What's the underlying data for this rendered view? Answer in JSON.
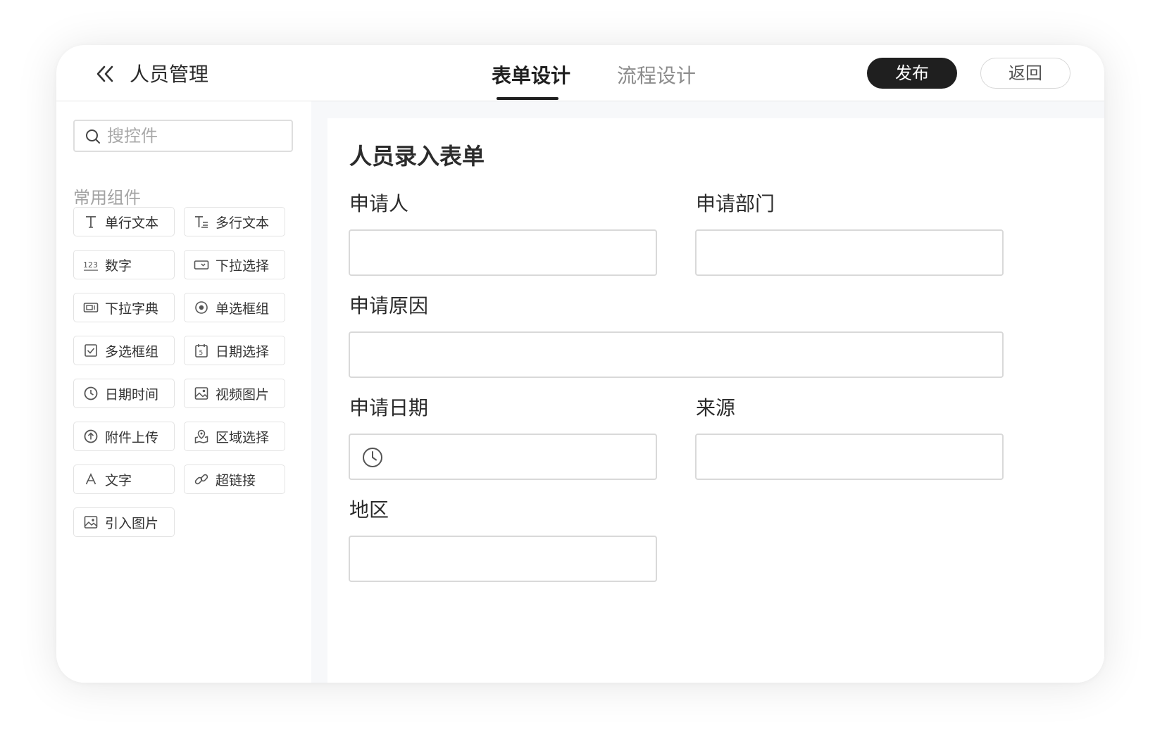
{
  "header": {
    "app_title": "人员管理",
    "tabs": [
      {
        "label": "表单设计",
        "active": true
      },
      {
        "label": "流程设计",
        "active": false
      }
    ],
    "publish_label": "发布",
    "back_label": "返回"
  },
  "sidebar": {
    "search": {
      "placeholder": "搜控件",
      "value": ""
    },
    "section_title": "常用组件",
    "components": [
      {
        "label": "单行文本",
        "icon": "text-icon"
      },
      {
        "label": "多行文本",
        "icon": "multiline-text-icon"
      },
      {
        "label": "数字",
        "icon": "number-icon"
      },
      {
        "label": "下拉选择",
        "icon": "dropdown-icon"
      },
      {
        "label": "下拉字典",
        "icon": "dictionary-icon"
      },
      {
        "label": "单选框组",
        "icon": "radio-icon"
      },
      {
        "label": "多选框组",
        "icon": "checkbox-icon"
      },
      {
        "label": "日期选择",
        "icon": "calendar-icon"
      },
      {
        "label": "日期时间",
        "icon": "clock-icon"
      },
      {
        "label": "视频图片",
        "icon": "media-icon"
      },
      {
        "label": "附件上传",
        "icon": "upload-icon"
      },
      {
        "label": "区域选择",
        "icon": "map-icon"
      },
      {
        "label": "文字",
        "icon": "font-icon"
      },
      {
        "label": "超链接",
        "icon": "link-icon"
      },
      {
        "label": "引入图片",
        "icon": "image-icon"
      }
    ]
  },
  "form": {
    "title": "人员录入表单",
    "fields": [
      {
        "label": "申请人",
        "value": ""
      },
      {
        "label": "申请部门",
        "value": ""
      },
      {
        "label": "申请原因",
        "value": ""
      },
      {
        "label": "申请日期",
        "value": "",
        "icon": "clock-icon"
      },
      {
        "label": "来源",
        "value": ""
      },
      {
        "label": "地区",
        "value": ""
      }
    ]
  },
  "colors": {
    "primary_dark": "#1f1f1f",
    "border": "#d9d9d9",
    "muted_text": "#8c8c8c",
    "canvas_bg": "#f7f8fa"
  }
}
